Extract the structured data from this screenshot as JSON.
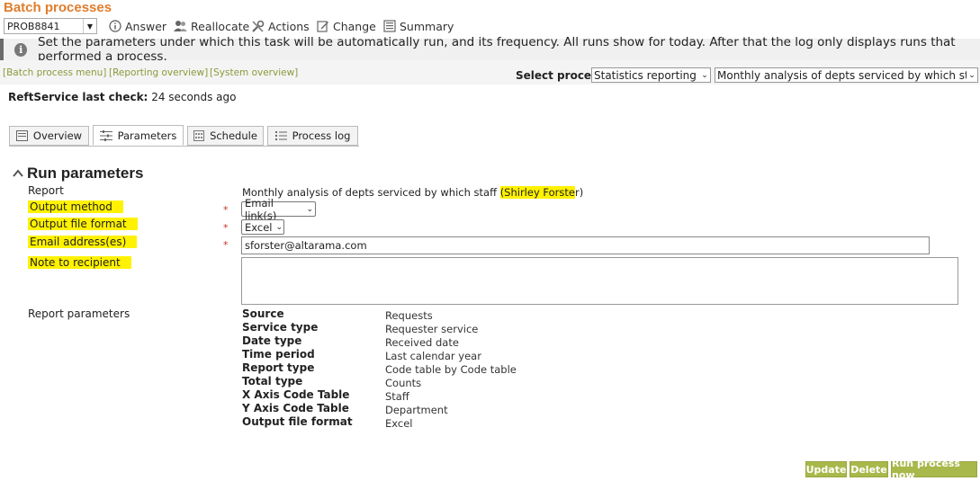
{
  "title": "Batch processes",
  "problem_combo": {
    "value": "PROB8841"
  },
  "toolbar": {
    "answer": "Answer",
    "reallocate": "Reallocate",
    "actions": "Actions",
    "change": "Change",
    "summary": "Summary"
  },
  "info_message": "Set the parameters under which this task will be automatically run, and its frequency. All runs show for today. After that the log only displays runs that performed a process.",
  "links": {
    "batch_menu": "[Batch process menu]",
    "reporting": "[Reporting overview]",
    "system": "[System overview]"
  },
  "select_process": {
    "label": "Select process",
    "category": "Statistics reporting",
    "process": "Monthly analysis of depts serviced by which staff ( sf )"
  },
  "last_check": {
    "label": "ReftService last check:",
    "value": "24 seconds ago"
  },
  "tabs": [
    {
      "label": "Overview"
    },
    {
      "label": "Parameters"
    },
    {
      "label": "Schedule"
    },
    {
      "label": "Process log"
    }
  ],
  "section_title": "Run parameters",
  "form": {
    "report_label": "Report",
    "report_value": "Monthly analysis of depts serviced by which staff",
    "report_owner": "(Shirley Forste",
    "report_owner_end": "r)",
    "output_method_label": "Output method",
    "output_method_value": "Email link(s)",
    "output_format_label": "Output file format",
    "output_format_value": "Excel",
    "email_label": "Email address(es)",
    "email_value": "sforster@altarama.com",
    "note_label": "Note to recipient",
    "note_value": "",
    "report_params_label": "Report parameters",
    "required_mark": "*"
  },
  "report_parameters": [
    {
      "key": "Source",
      "value": "Requests"
    },
    {
      "key": "Service type",
      "value": "Requester service"
    },
    {
      "key": "Date type",
      "value": "Received date"
    },
    {
      "key": "Time period",
      "value": "Last calendar year"
    },
    {
      "key": "Report type",
      "value": "Code table by Code table"
    },
    {
      "key": "Total type",
      "value": "Counts"
    },
    {
      "key": "X Axis Code Table",
      "value": "Staff"
    },
    {
      "key": "Y Axis Code Table",
      "value": "Department"
    },
    {
      "key": "Output file format",
      "value": "Excel"
    }
  ],
  "buttons": {
    "update": "Update",
    "delete": "Delete",
    "run_now": "Run process now"
  },
  "colors": {
    "title": "#e07d2c",
    "link": "#8a9a3a",
    "button": "#a9b84a",
    "highlight": "#fff200",
    "required": "#c0392b"
  }
}
